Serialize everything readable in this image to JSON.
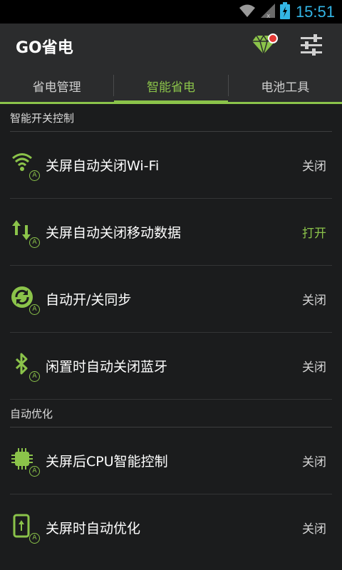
{
  "status_bar": {
    "time": "15:51",
    "icons": [
      "wifi-icon",
      "signal-off-icon",
      "battery-charging-icon"
    ]
  },
  "app_bar": {
    "title": "GO省电",
    "icons": [
      "diamond-icon",
      "settings-sliders-icon"
    ],
    "accent": "#8bc34a",
    "badge_color": "#e53935"
  },
  "tabs": [
    {
      "label": "省电管理",
      "active": false
    },
    {
      "label": "智能省电",
      "active": true
    },
    {
      "label": "电池工具",
      "active": false
    }
  ],
  "sections": [
    {
      "title": "智能开关控制",
      "items": [
        {
          "icon": "wifi-icon",
          "label": "关屏自动关闭Wi-Fi",
          "status": "关闭",
          "on": false
        },
        {
          "icon": "mobile-data-icon",
          "label": "关屏自动关闭移动数据",
          "status": "打开",
          "on": true
        },
        {
          "icon": "sync-icon",
          "label": "自动开/关同步",
          "status": "关闭",
          "on": false
        },
        {
          "icon": "bluetooth-icon",
          "label": "闲置时自动关闭蓝牙",
          "status": "关闭",
          "on": false
        }
      ]
    },
    {
      "title": "自动优化",
      "items": [
        {
          "icon": "cpu-icon",
          "label": "关屏后CPU智能控制",
          "status": "关闭",
          "on": false
        },
        {
          "icon": "phone-optimize-icon",
          "label": "关屏时自动优化",
          "status": "关闭",
          "on": false
        }
      ]
    }
  ],
  "auto_badge_text": "A"
}
